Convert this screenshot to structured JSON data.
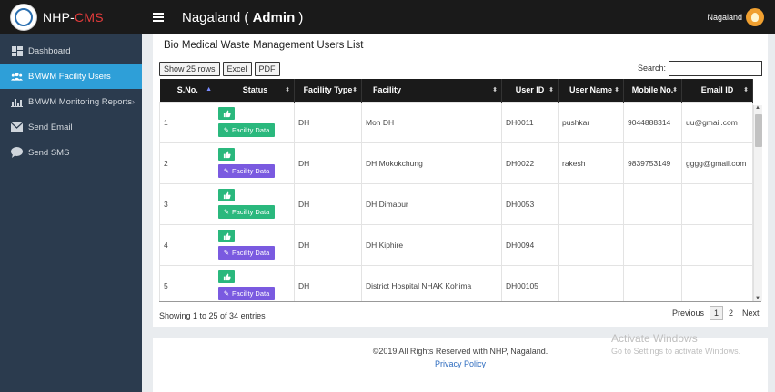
{
  "app": {
    "brand_prefix": "NHP-",
    "brand_suffix": "CMS",
    "logo_icon": "nhp-logo"
  },
  "sidebar": {
    "items": [
      {
        "label": "Dashboard",
        "icon": "dashboard-icon",
        "active": false
      },
      {
        "label": "BMWM Facility Users",
        "icon": "users-icon",
        "active": true
      },
      {
        "label": "BMWM Monitoring Reports",
        "icon": "bar-chart-icon",
        "active": false,
        "has_submenu": true
      },
      {
        "label": "Send Email",
        "icon": "envelope-icon",
        "active": false
      },
      {
        "label": "Send SMS",
        "icon": "chat-icon",
        "active": false
      }
    ]
  },
  "topbar": {
    "title_prefix": "Nagaland ( ",
    "title_bold": "Admin",
    "title_suffix": " )",
    "user_name": "Nagaland"
  },
  "page": {
    "title": "Bio Medical Waste Management Users List"
  },
  "toolbar": {
    "rows_button": "Show 25 rows",
    "excel_button": "Excel",
    "pdf_button": "PDF",
    "search_label": "Search:",
    "search_value": ""
  },
  "table": {
    "headers": [
      "S.No.",
      "Status",
      "Facility Type",
      "Facility",
      "User ID",
      "User Name",
      "Mobile No.",
      "Email ID"
    ],
    "status_button_label": "Facility Data",
    "rows": [
      {
        "sno": "1",
        "facility_type": "DH",
        "facility": "Mon DH",
        "user_id": "DH0011",
        "user_name": "pushkar",
        "mobile": "9044888314",
        "email": "uu@gmail.com",
        "fd_color": "green"
      },
      {
        "sno": "2",
        "facility_type": "DH",
        "facility": "DH Mokokchung",
        "user_id": "DH0022",
        "user_name": "rakesh",
        "mobile": "9839753149",
        "email": "gggg@gmail.com",
        "fd_color": "purple"
      },
      {
        "sno": "3",
        "facility_type": "DH",
        "facility": "DH Dimapur",
        "user_id": "DH0053",
        "user_name": "",
        "mobile": "",
        "email": "",
        "fd_color": "green"
      },
      {
        "sno": "4",
        "facility_type": "DH",
        "facility": "DH Kiphire",
        "user_id": "DH0094",
        "user_name": "",
        "mobile": "",
        "email": "",
        "fd_color": "purple"
      },
      {
        "sno": "5",
        "facility_type": "DH",
        "facility": "District Hospital NHAK Kohima",
        "user_id": "DH00105",
        "user_name": "",
        "mobile": "",
        "email": "",
        "fd_color": "purple"
      }
    ]
  },
  "pagination": {
    "info": "Showing 1 to 25 of 34 entries",
    "previous": "Previous",
    "pages": [
      "1",
      "2"
    ],
    "current": "1",
    "next": "Next"
  },
  "footer": {
    "copyright": "©2019 All Rights Reserved with NHP, Nagaland.",
    "privacy": "Privacy Policy"
  },
  "watermark": {
    "line1": "Activate Windows",
    "line2": "Go to Settings to activate Windows."
  },
  "colors": {
    "sidebar_bg": "#2b3b4e",
    "active_nav": "#2e9fd8",
    "topbar_bg": "#1a1a1a",
    "green_button": "#2ab87d",
    "purple_button": "#7a5ae0",
    "brand_accent": "#e23b3b"
  }
}
